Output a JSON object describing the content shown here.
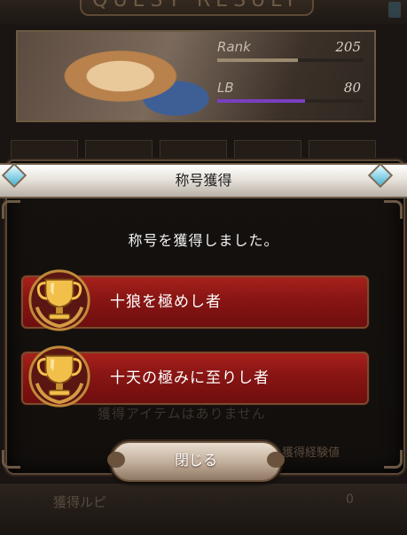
{
  "background": {
    "header_title": "QUEST RESULT",
    "profile": {
      "rank_label": "Rank",
      "rank_value": "205",
      "rank_progress": 0.55,
      "lb_label": "LB",
      "lb_value": "80",
      "lb_progress": 0.6
    },
    "bottom_text": "獲得ルピ",
    "bottom_value": "0",
    "faded_button": "獲得経験値"
  },
  "modal": {
    "title": "称号獲得",
    "message": "称号を獲得しました。",
    "titles": [
      {
        "label": "十狼を極めし者"
      },
      {
        "label": "十天の極みに至りし者"
      }
    ],
    "ghost_text": "獲得アイテムはありません",
    "close_label": "閉じる"
  },
  "colors": {
    "title_bar_red": "#8a1614",
    "rank_bar": "#9b8a70",
    "lb_bar": "#7a3fc0",
    "gem": "#4ab4d3"
  }
}
